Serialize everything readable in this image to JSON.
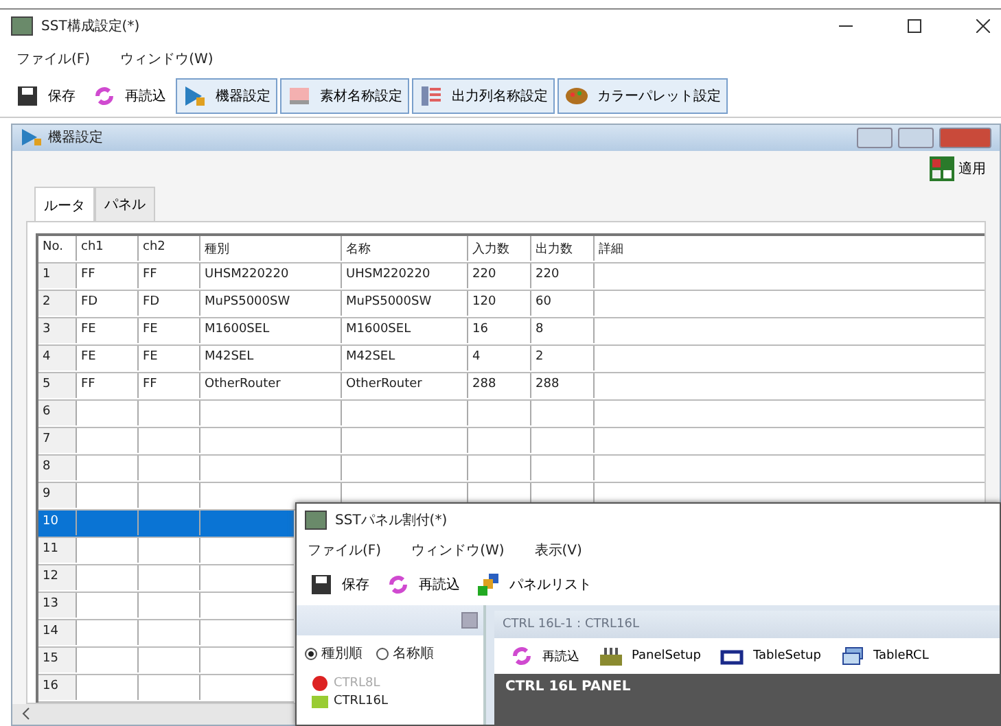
{
  "main_window": {
    "title": "SST構成設定(*)",
    "menu": [
      "ファイル(F)",
      "ウィンドウ(W)"
    ],
    "toolbar": [
      {
        "label": "保存",
        "kind": "save",
        "selected": false
      },
      {
        "label": "再読込",
        "kind": "reload",
        "selected": false
      },
      {
        "label": "機器設定",
        "kind": "device",
        "selected": true
      },
      {
        "label": "素材名称設定",
        "kind": "source",
        "selected": true
      },
      {
        "label": "出力列名称設定",
        "kind": "output",
        "selected": true
      },
      {
        "label": "カラーパレット設定",
        "kind": "palette",
        "selected": true
      }
    ]
  },
  "device_window": {
    "title": "機器設定",
    "apply_button": "適用",
    "tabs": [
      {
        "label": "ルータ",
        "selected": true
      },
      {
        "label": "パネル",
        "selected": false
      }
    ],
    "table": {
      "columns": [
        "No.",
        "ch1",
        "ch2",
        "種別",
        "名称",
        "入力数",
        "出力数",
        "詳細"
      ],
      "rows": [
        {
          "cells": [
            "1",
            "FF",
            "FF",
            "UHSM220220",
            "UHSM220220",
            "220",
            "220"
          ],
          "selected": false
        },
        {
          "cells": [
            "2",
            "FD",
            "FD",
            "MuPS5000SW",
            "MuPS5000SW",
            "120",
            "60"
          ],
          "selected": false
        },
        {
          "cells": [
            "3",
            "FE",
            "FE",
            "M1600SEL",
            "M1600SEL",
            "16",
            "8"
          ],
          "selected": false
        },
        {
          "cells": [
            "4",
            "FE",
            "FE",
            "M42SEL",
            "M42SEL",
            "4",
            "2"
          ],
          "selected": false
        },
        {
          "cells": [
            "5",
            "FF",
            "FF",
            "OtherRouter",
            "OtherRouter",
            "288",
            "288"
          ],
          "selected": false
        },
        {
          "cells": [
            "6"
          ],
          "selected": false
        },
        {
          "cells": [
            "7"
          ],
          "selected": false
        },
        {
          "cells": [
            "8"
          ],
          "selected": false
        },
        {
          "cells": [
            "9"
          ],
          "selected": false
        },
        {
          "cells": [
            "10"
          ],
          "selected": true
        },
        {
          "cells": [
            "11"
          ],
          "selected": false
        },
        {
          "cells": [
            "12"
          ],
          "selected": false
        },
        {
          "cells": [
            "13"
          ],
          "selected": false
        },
        {
          "cells": [
            "14"
          ],
          "selected": false
        },
        {
          "cells": [
            "15"
          ],
          "selected": false
        },
        {
          "cells": [
            "16"
          ],
          "selected": false
        }
      ]
    }
  },
  "panel_window": {
    "title": "SSTパネル割付(*)",
    "menu": [
      "ファイル(F)",
      "ウィンドウ(W)",
      "表示(V)"
    ],
    "toolbar": [
      {
        "label": "保存",
        "kind": "save"
      },
      {
        "label": "再読込",
        "kind": "reload"
      },
      {
        "label": "パネルリスト",
        "kind": "list"
      }
    ],
    "sort_options": [
      {
        "label": "種別順",
        "selected": true
      },
      {
        "label": "名称順",
        "selected": false
      }
    ],
    "tree": [
      {
        "label": "CTRL8L",
        "disabled": true
      },
      {
        "label": "CTRL16L",
        "disabled": false
      }
    ],
    "child_title": "CTRL 16L-1 : CTRL16L",
    "child_toolbar": [
      {
        "label": "再読込",
        "kind": "reload"
      },
      {
        "label": "PanelSetup",
        "kind": "panel"
      },
      {
        "label": "TableSetup",
        "kind": "table"
      },
      {
        "label": "TableRCL",
        "kind": "rcl"
      }
    ],
    "panel_header": "CTRL 16L PANEL"
  }
}
